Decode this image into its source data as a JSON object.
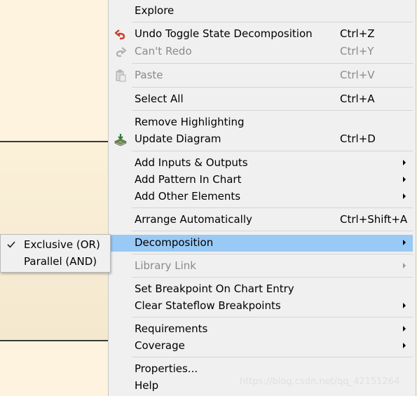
{
  "menu": {
    "explore": "Explore",
    "undo": {
      "label": "Undo Toggle State Decomposition",
      "shortcut": "Ctrl+Z"
    },
    "redo": {
      "label": "Can't Redo",
      "shortcut": "Ctrl+Y"
    },
    "paste": {
      "label": "Paste",
      "shortcut": "Ctrl+V"
    },
    "select_all": {
      "label": "Select All",
      "shortcut": "Ctrl+A"
    },
    "remove_highlighting": "Remove Highlighting",
    "update_diagram": {
      "label": "Update Diagram",
      "shortcut": "Ctrl+D"
    },
    "add_inputs_outputs": "Add Inputs & Outputs",
    "add_pattern": "Add Pattern In Chart",
    "add_other": "Add Other Elements",
    "arrange": {
      "label": "Arrange Automatically",
      "shortcut": "Ctrl+Shift+A"
    },
    "decomposition": "Decomposition",
    "library_link": "Library Link",
    "set_breakpoint": "Set Breakpoint On Chart Entry",
    "clear_breakpoints": "Clear Stateflow Breakpoints",
    "requirements": "Requirements",
    "coverage": "Coverage",
    "properties": "Properties...",
    "help": "Help"
  },
  "submenu": {
    "exclusive": "Exclusive (OR)",
    "parallel": "Parallel (AND)",
    "checked": "exclusive"
  },
  "watermark": "https://blog.csdn.net/qq_42151264",
  "colors": {
    "highlight": "#99c9f5",
    "menu_bg": "#f0f0f0",
    "canvas_bg": "#fdf3df"
  }
}
